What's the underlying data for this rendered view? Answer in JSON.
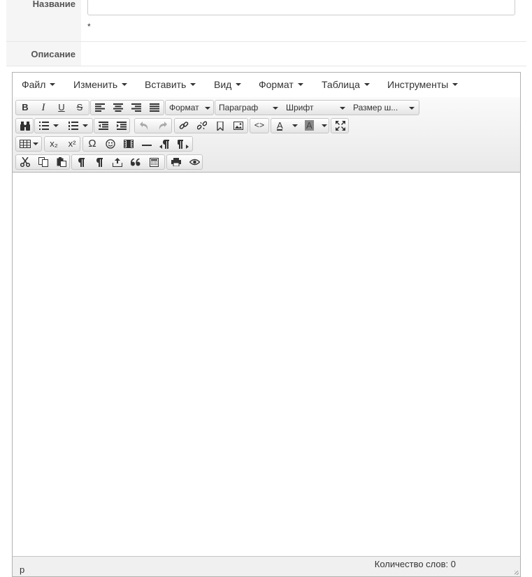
{
  "form": {
    "name_label": "Название",
    "name_value": "",
    "required_mark": "*",
    "description_label": "Описание"
  },
  "menubar": {
    "items": [
      "Файл",
      "Изменить",
      "Вставить",
      "Вид",
      "Формат",
      "Таблица",
      "Инструменты"
    ]
  },
  "toolbar": {
    "row1": {
      "bold": "B",
      "italic": "I",
      "underline": "U",
      "strike": "S",
      "format_select": "Формат",
      "paragraph_select": "Параграф",
      "font_select": "Шрифт",
      "size_select": "Размер ш..."
    },
    "row2": {
      "code": "<>",
      "forecolor": "A",
      "backcolor": "A"
    },
    "row3": {
      "subscript": "x₂",
      "superscript": "x²",
      "charmap": "Ω"
    }
  },
  "statusbar": {
    "path": "p",
    "word_count": "Количество слов: 0"
  },
  "colors": {
    "accent": "#b1b1b1",
    "label_bg": "#f5f5f5",
    "toolbar_bg": "#ececec"
  }
}
